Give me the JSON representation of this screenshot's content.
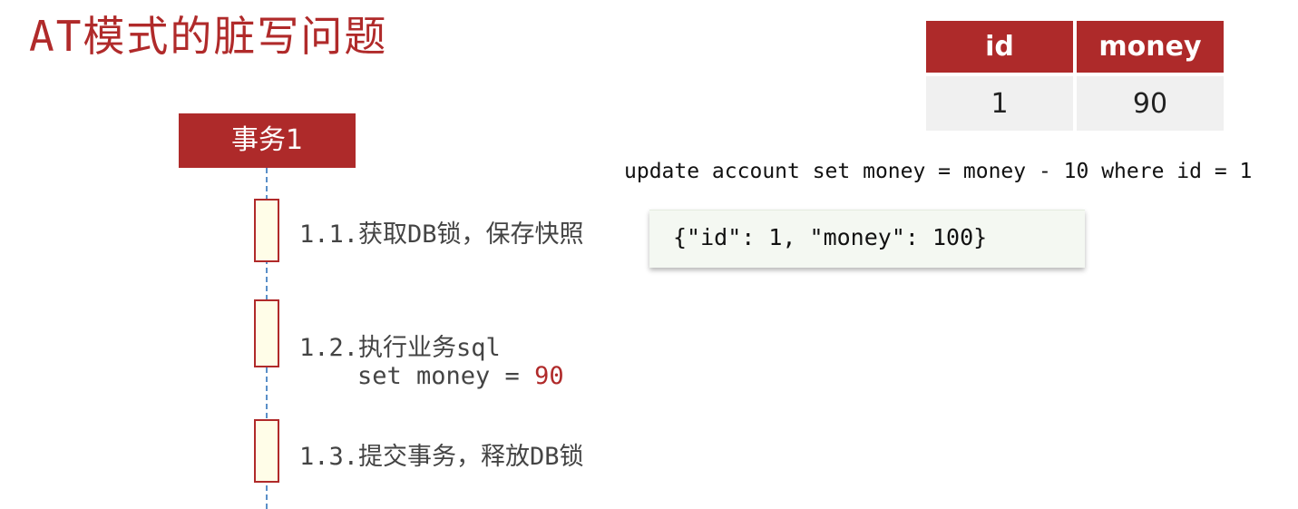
{
  "title": "AT模式的脏写问题",
  "table": {
    "headers": [
      "id",
      "money"
    ],
    "row": [
      "1",
      "90"
    ]
  },
  "sql": "update account set money = money - 10 where id = 1",
  "snapshot": "{\"id\": 1, \"money\": 100}",
  "transaction": {
    "label": "事务1",
    "steps": [
      {
        "text": "1.1.获取DB锁，保存快照"
      },
      {
        "text": "1.2.执行业务sql",
        "code_prefix": "set money = ",
        "code_value": "90"
      },
      {
        "text": "1.3.提交事务，释放DB锁"
      }
    ]
  },
  "colors": {
    "accent": "#ae2a2a",
    "lifeline": "#5a8fc8",
    "activation_fill": "#fffde8",
    "snapshot_bg": "#f4f8f2"
  }
}
